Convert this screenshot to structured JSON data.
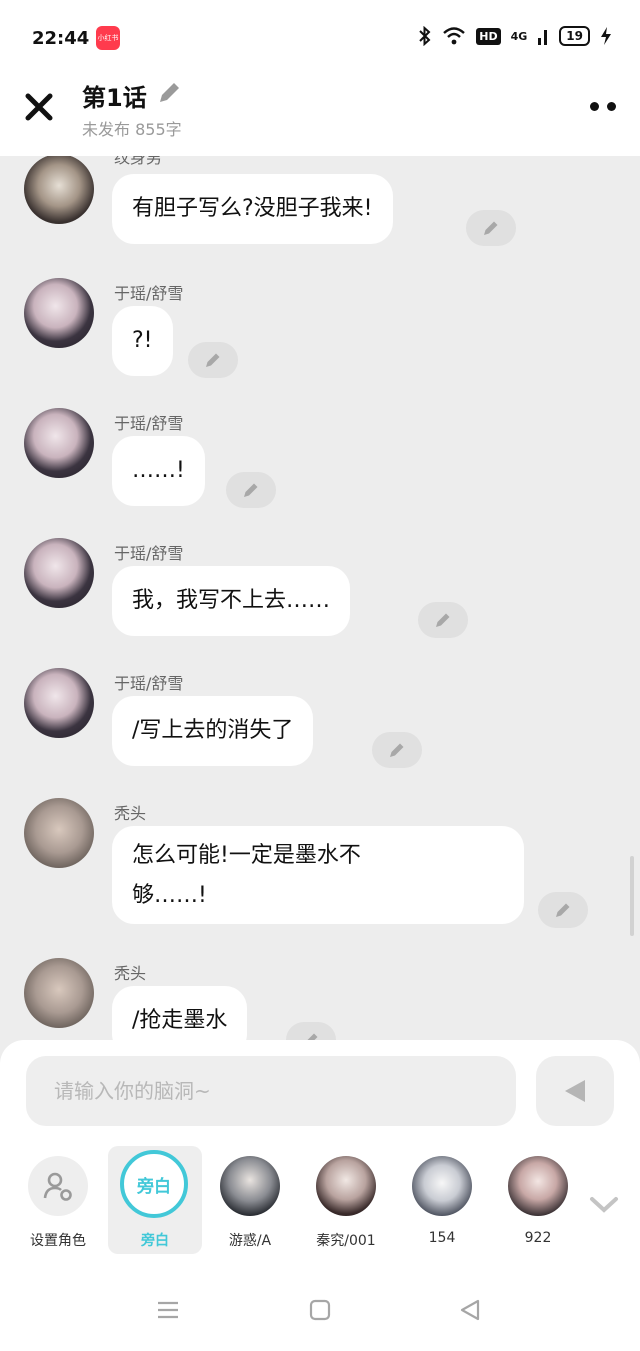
{
  "status_bar": {
    "time": "22:44",
    "app_badge": "小红书",
    "hd": "HD",
    "network": "4G",
    "battery": "19"
  },
  "header": {
    "title": "第1话",
    "subtitle": "未发布 855字"
  },
  "messages": [
    {
      "sender": "纹身男",
      "text": "有胆子写么?没胆子我来!",
      "avatar": "man"
    },
    {
      "sender": "于瑶/舒雪",
      "text": "?!",
      "avatar": "girl"
    },
    {
      "sender": "于瑶/舒雪",
      "text": "……!",
      "avatar": "girl"
    },
    {
      "sender": "于瑶/舒雪",
      "text": "我，我写不上去……",
      "avatar": "girl"
    },
    {
      "sender": "于瑶/舒雪",
      "text": "/写上去的消失了",
      "avatar": "girl"
    },
    {
      "sender": "秃头",
      "text_line1": "怎么可能!一定是墨水不",
      "text_line2": "够……!",
      "avatar": "old"
    },
    {
      "sender": "秃头",
      "text": "/抢走墨水",
      "avatar": "old"
    }
  ],
  "composer": {
    "placeholder": "请输入你的脑洞~"
  },
  "roles": [
    {
      "label": "设置角色",
      "icon": "user-settings-icon"
    },
    {
      "label": "旁白",
      "circle_text": "旁白",
      "selected": true
    },
    {
      "label": "游惑/A"
    },
    {
      "label": "秦究/001"
    },
    {
      "label": "154"
    },
    {
      "label": "922"
    }
  ],
  "colors": {
    "accent": "#42c8d8",
    "background": "#ededed",
    "bubble": "#ffffff",
    "edit_button": "#e0e0e0"
  }
}
